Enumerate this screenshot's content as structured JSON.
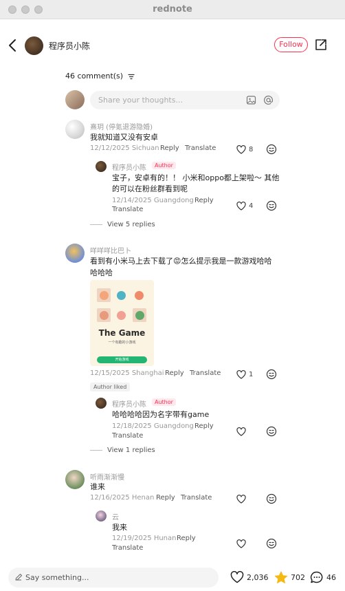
{
  "window": {
    "title": "rednote"
  },
  "header": {
    "author_name": "程序员小陈",
    "follow_label": "Follow"
  },
  "comments_header": {
    "count_label": "46 comment(s)"
  },
  "composer": {
    "placeholder": "Share your thoughts..."
  },
  "comments": [
    {
      "user": "熹玥 (停氪退游隐婚)",
      "text": "我就知道又没有安卓",
      "date_location": "12/12/2025 Sichuan",
      "reply_label": "Reply",
      "translate_label": "Translate",
      "likes": "8",
      "reply": {
        "user": "程序员小陈",
        "badge": "Author",
        "text_line1": "宝子，安卓有的！！ 小米和oppo都上架啦～ 其他",
        "text_line2": "的可以在粉丝群看到呢",
        "date_location": "12/14/2025 Guangdong",
        "reply_label": "Reply",
        "translate_label": "Translate",
        "likes": "4"
      },
      "view_replies": "View 5 replies"
    },
    {
      "user": "咩咩咩比巴卜",
      "text_line1": "看到有小米马上去下载了😡怎么提示我是一款游戏哈哈",
      "text_line2": "哈哈哈",
      "image": {
        "title": "The Game",
        "subtitle": "一个有趣的小游戏",
        "button": "开始游戏"
      },
      "date_location": "12/15/2025 Shanghai",
      "reply_label": "Reply",
      "translate_label": "Translate",
      "likes": "1",
      "author_liked": "Author liked",
      "reply": {
        "user": "程序员小陈",
        "badge": "Author",
        "text": "哈哈哈哈因为名字带有game",
        "date_location": "12/18/2025 Guangdong",
        "reply_label": "Reply",
        "translate_label": "Translate"
      },
      "view_replies": "View 1 replies"
    },
    {
      "user": "听雨渐渐慢",
      "text": "谁来",
      "date_location": "12/16/2025 Henan",
      "reply_label": "Reply",
      "translate_label": "Translate",
      "reply": {
        "user": "云",
        "text": "我来",
        "date_location": "12/19/2025 Hunan",
        "reply_label": "Reply",
        "translate_label": "Translate"
      }
    }
  ],
  "bottom_bar": {
    "placeholder": "Say something...",
    "likes": "2,036",
    "stars": "702",
    "comments": "46"
  },
  "colors": {
    "accent": "#ff2e4d",
    "star": "#f5b914",
    "muted": "#999999"
  }
}
